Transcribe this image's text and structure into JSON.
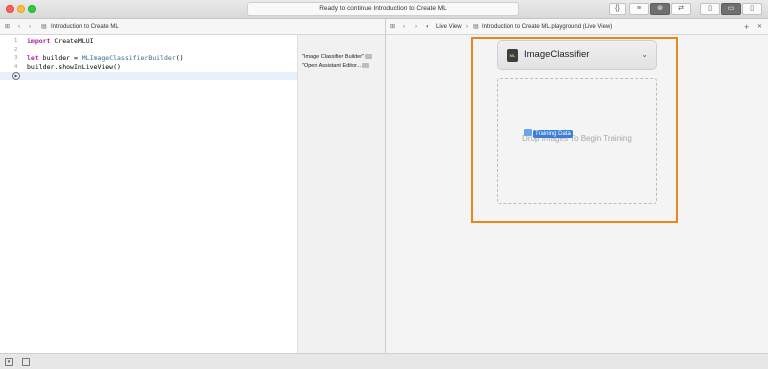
{
  "toolbar": {
    "status_text": "Ready to continue Introduction to Create ML",
    "buttons": [
      "{}",
      "≡",
      "⊚",
      "⇄",
      "▯",
      "▭",
      "▯"
    ]
  },
  "editor_jumpbar": {
    "file_name": "Introduction to Create ML"
  },
  "liveview_jumpbar": {
    "mode": "Live View",
    "file_name": "Introduction to Create ML.playground (Live View)"
  },
  "code": {
    "line_numbers": [
      "1",
      "2",
      "3",
      "4"
    ],
    "line1_keyword": "import",
    "line1_rest": " CreateMLUI",
    "line3_keyword": "let",
    "line3_mid": " builder = ",
    "line3_type": "MLImageClassifierBuilder",
    "line3_end": "()",
    "line4": "builder.showInLiveView()"
  },
  "results": {
    "line3": "\"Image Classifier Builder\"",
    "line4": "\"Open Assistant Editor..."
  },
  "live_view": {
    "icon_text": "ML",
    "classifier_title": "ImageClassifier",
    "drop_text": "Drop Images To Begin Training",
    "drag_label": "Training Data"
  },
  "colors": {
    "highlight_border": "#e8871e",
    "keyword": "#a5269a",
    "drag_label_bg": "#3a7fd5"
  }
}
